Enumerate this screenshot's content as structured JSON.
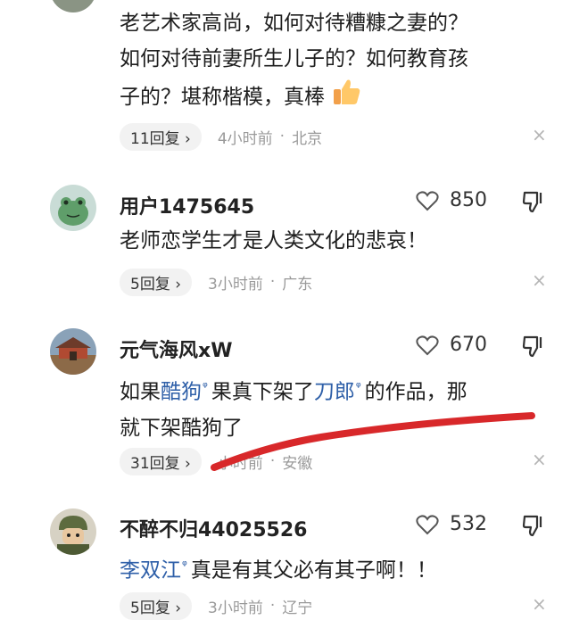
{
  "comments": [
    {
      "body_lines": [
        "老艺术家高尚，如何对待糟糠之妻的？",
        "如何对待前妻所生儿子的？如何教育孩",
        "子的？堪称楷模，真棒"
      ],
      "reply_label": "11回复 ›",
      "time": "4小时前",
      "separator": "·",
      "location": "北京",
      "close": "×"
    },
    {
      "username": "用户1475645",
      "likes": "850",
      "body": "老师恋学生才是人类文化的悲哀！",
      "reply_label": "5回复 ›",
      "time": "3小时前",
      "separator": "·",
      "location": "广东",
      "close": "×"
    },
    {
      "username": "元气海风xW",
      "likes": "670",
      "body_parts": {
        "p1": "如果",
        "link1": "酷狗",
        "p2": "果真下架了",
        "link2": "刀郎",
        "p3": "的作品，那",
        "line2": "就下架酷狗了"
      },
      "reply_label": "31回复 ›",
      "time": "小时前",
      "separator": "·",
      "location": "安徽",
      "close": "×"
    },
    {
      "username": "不醉不归44025526",
      "likes": "532",
      "body_parts": {
        "link1": "李双江",
        "p1": "真是有其父必有其子啊！！"
      },
      "reply_label": "5回复 ›",
      "time": "3小时前",
      "separator": "·",
      "location": "辽宁",
      "close": "×"
    }
  ],
  "search_glyph": "ᵠ",
  "colors": {
    "link": "#2e5fa8",
    "annotation_stroke": "#d8282a",
    "meta_text": "#9a9a9a"
  },
  "icons": {
    "like": "heart-outline-icon",
    "dislike": "thumbs-down-icon",
    "close": "close-icon",
    "emoji": "thumbs-up-emoji-icon"
  }
}
